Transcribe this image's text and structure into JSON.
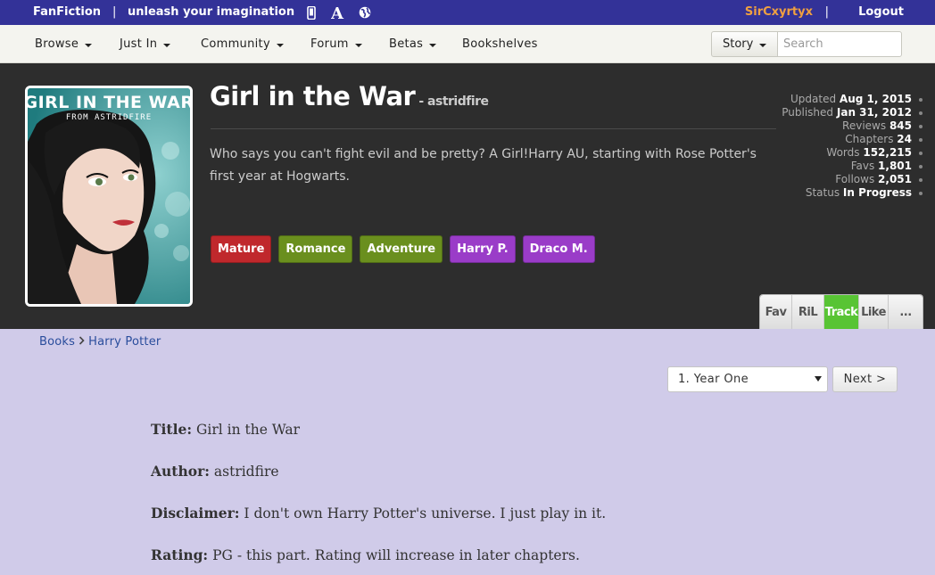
{
  "topbar": {
    "brand": "FanFiction",
    "separator": "|",
    "tagline": "unleash your imagination",
    "icons": [
      "mobile-icon",
      "font-size-icon",
      "globe-icon"
    ],
    "username": "SirCxyrtyx",
    "user_separator": "|",
    "logout": "Logout"
  },
  "nav": {
    "items": [
      {
        "label": "Browse",
        "dropdown": true
      },
      {
        "label": "Just In",
        "dropdown": true
      },
      {
        "label": "Community",
        "dropdown": true
      },
      {
        "label": "Forum",
        "dropdown": true
      },
      {
        "label": "Betas",
        "dropdown": true
      },
      {
        "label": "Bookshelves",
        "dropdown": false
      }
    ],
    "search_scope": "Story",
    "search_placeholder": "Search"
  },
  "story": {
    "cover": {
      "title_text": "GIRL IN THE WAR",
      "subtitle_text": "FROM ASTRIDFIRE"
    },
    "title": "Girl in the War",
    "author_prefix": "- astridfire",
    "summary": "Who says you can't fight evil and be pretty? A Girl!Harry AU, starting with Rose Potter's first year at Hogwarts.",
    "tags": [
      {
        "label": "Mature",
        "color": "#c0282c"
      },
      {
        "label": "Romance",
        "color": "#6a8f1e"
      },
      {
        "label": "Adventure",
        "color": "#6a8f1e"
      },
      {
        "label": "Harry P.",
        "color": "#9a3cc8"
      },
      {
        "label": "Draco M.",
        "color": "#9a3cc8"
      }
    ],
    "stats": [
      {
        "label": "Updated",
        "value": "Aug 1, 2015"
      },
      {
        "label": "Published",
        "value": "Jan 31, 2012"
      },
      {
        "label": "Reviews",
        "value": "845"
      },
      {
        "label": "Chapters",
        "value": "24"
      },
      {
        "label": "Words",
        "value": "152,215"
      },
      {
        "label": "Favs",
        "value": "1,801"
      },
      {
        "label": "Follows",
        "value": "2,051"
      },
      {
        "label": "Status",
        "value": "In Progress"
      }
    ],
    "actions": [
      "Fav",
      "RiL",
      "Track",
      "Like",
      "..."
    ],
    "active_action": "Track",
    "active_action_color": "#58c434"
  },
  "breadcrumb": {
    "items": [
      "Books",
      "Harry Potter"
    ]
  },
  "chapter_nav": {
    "selected": "1. Year One",
    "next_label": "Next >"
  },
  "body": {
    "lines": [
      {
        "label": "Title:",
        "text": "Girl in the War"
      },
      {
        "label": "Author:",
        "text": "astridfire"
      },
      {
        "label": "Disclaimer:",
        "text": "I don't own Harry Potter's universe. I just play in it."
      },
      {
        "label": "Rating:",
        "text": "PG - this part. Rating will increase in later chapters."
      }
    ]
  },
  "colors": {
    "topbar_bg": "#333298",
    "header_bg": "#2d2d2d",
    "page_bg": "#d0cbe9",
    "username": "#f0a040",
    "link": "#2a4d9c"
  }
}
